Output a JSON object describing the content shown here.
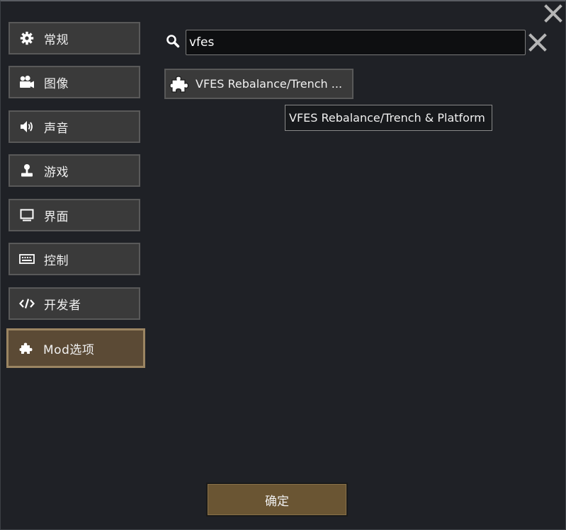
{
  "sidebar": {
    "items": [
      {
        "label": "常规",
        "icon": "gear-icon",
        "active": false
      },
      {
        "label": "图像",
        "icon": "camera-icon",
        "active": false
      },
      {
        "label": "声音",
        "icon": "speaker-icon",
        "active": false
      },
      {
        "label": "游戏",
        "icon": "joystick-icon",
        "active": false
      },
      {
        "label": "界面",
        "icon": "monitor-icon",
        "active": false
      },
      {
        "label": "控制",
        "icon": "keyboard-icon",
        "active": false
      },
      {
        "label": "开发者",
        "icon": "code-icon",
        "active": false
      },
      {
        "label": "Mod选项",
        "icon": "puzzle-icon",
        "active": true
      }
    ]
  },
  "search": {
    "value": "vfes",
    "placeholder": ""
  },
  "results": [
    {
      "label": "VFES Rebalance/Trench ...",
      "tooltip": "VFES Rebalance/Trench & Platform"
    }
  ],
  "footer": {
    "confirm_label": "确定"
  },
  "colors": {
    "background": "#1f2126",
    "button": "#3a3a3a",
    "active": "#5b4a35",
    "confirm": "#6a5533"
  }
}
